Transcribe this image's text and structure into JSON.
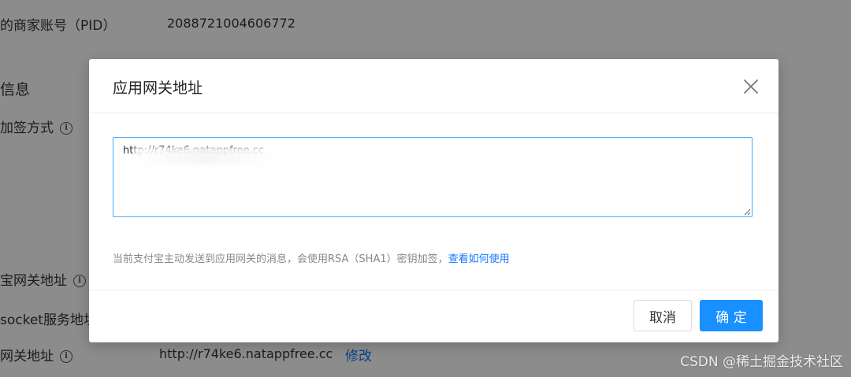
{
  "background": {
    "merchant_pid_label": "的商家账号（PID）",
    "merchant_pid_value": "2088721004606772",
    "section_title": "信息",
    "sign_method_label": "加签方式",
    "alipay_gateway_label": "宝网关地址",
    "socket_service_label": "socket服务地址",
    "app_gateway_label": "网关地址",
    "app_gateway_value": "http://r74ke6.natappfree.cc",
    "modify_link": "修改",
    "info_icon_glyph": "i"
  },
  "modal": {
    "title": "应用网关地址",
    "textarea_value": "http://r74ke6.natappfree.cc",
    "hint_text": "当前支付宝主动发送到应用网关的消息，会使用RSA（SHA1）密钥加签，",
    "hint_link": "查看如何使用",
    "cancel_label": "取消",
    "ok_label": "确 定"
  },
  "watermark": "CSDN @稀土掘金技术社区",
  "colors": {
    "primary": "#1890ff",
    "link": "#1677ff",
    "mask": "rgba(0,0,0,0.45)"
  }
}
